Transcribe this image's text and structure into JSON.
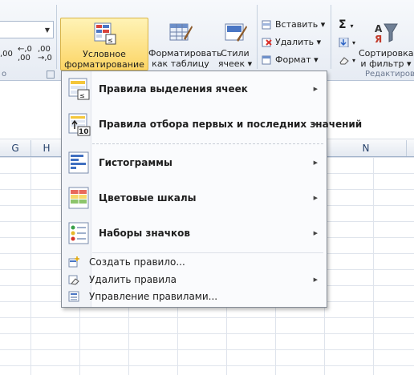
{
  "ribbon": {
    "number_group": {
      "dropdown_value": "",
      "buttons": [
        {
          "id": "thousands",
          "label": ",00"
        },
        {
          "id": "increase_decimal",
          "label": "←,0\n,00"
        },
        {
          "id": "decrease_decimal",
          "label": ",00\n→,0"
        }
      ],
      "group_label": "о"
    },
    "styles_group": {
      "conditional_formatting": {
        "line1": "Условное",
        "line2": "форматирование",
        "arrow": "▾"
      },
      "format_as_table": {
        "line1": "Форматировать",
        "line2": "как таблицу",
        "arrow": "▾"
      },
      "cell_styles": {
        "line1": "Стили",
        "line2": "ячеек",
        "arrow": "▾"
      }
    },
    "cells_group": {
      "insert": {
        "label": "Вставить",
        "arrow": "▾"
      },
      "delete": {
        "label": "Удалить",
        "arrow": "▾"
      },
      "format": {
        "label": "Формат",
        "arrow": "▾"
      }
    },
    "editing_group": {
      "sum_symbol": "Σ",
      "sort_filter": {
        "line1": "Сортировка",
        "line2": "и фильтр",
        "arrow": "▾"
      },
      "group_label": "Редактиров"
    }
  },
  "sheet": {
    "columns": [
      "G",
      "H",
      "N"
    ]
  },
  "menu": {
    "items": [
      {
        "id": "highlight_rules",
        "label": "Правила выделения ячеек",
        "has_submenu": true
      },
      {
        "id": "top_bottom_rules",
        "label": "Правила отбора первых и последних значений",
        "has_submenu": true
      },
      {
        "id": "data_bars",
        "label": "Гистограммы",
        "has_submenu": true
      },
      {
        "id": "color_scales",
        "label": "Цветовые шкалы",
        "has_submenu": true
      },
      {
        "id": "icon_sets",
        "label": "Наборы значков",
        "has_submenu": true
      }
    ],
    "actions": [
      {
        "id": "new_rule",
        "label": "Создать правило..."
      },
      {
        "id": "clear_rules",
        "label": "Удалить правила",
        "has_submenu": true
      },
      {
        "id": "manage_rules",
        "label": "Управление правилами..."
      }
    ],
    "submenu_arrow": "▶"
  }
}
